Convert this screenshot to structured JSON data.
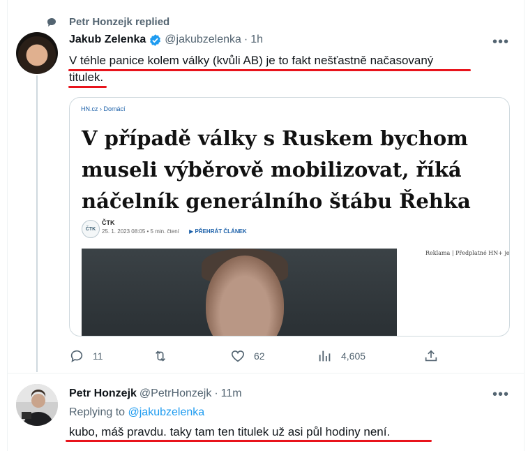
{
  "context": {
    "text": "Petr Honzejk replied",
    "icon": "reply-bubble-icon"
  },
  "tweet1": {
    "name": "Jakub Zelenka",
    "handle": "@jakubzelenka",
    "separator": "·",
    "time": "1h",
    "verified": true,
    "more": "•••",
    "text_line1": "V téhle panice kolem války (kvůli AB) je to fakt nešťastně načasovaný",
    "text_line2_underlined": "titulek",
    "text_line2_rest": ".",
    "card": {
      "breadcrumb": "HN.cz › Domácí",
      "headline": "V případě války s Ruskem bychom museli výběrově mobilizovat, říká náčelník generálního štábu Řehka",
      "author_logo": "ČTK",
      "author": "ČTK",
      "meta": "25. 1. 2023 08:05 • 5 min. čtení",
      "play_label": "▶ PŘEHRÁT ČLÁNEK",
      "ad_text": "Reklama | Předplatné HN+ je zce"
    },
    "actions": {
      "replies": "11",
      "retweets": "",
      "likes": "62",
      "views": "4,605"
    }
  },
  "tweet2": {
    "name": "Petr Honzejk",
    "handle": "@PetrHonzejk",
    "separator": "·",
    "time": "11m",
    "more": "•••",
    "replying_label": "Replying to",
    "replying_mention": "@jakubzelenka",
    "text": "kubo, máš pravdu. taky tam ten titulek už asi půl hodiny není."
  },
  "colors": {
    "accent": "#1d9bf0",
    "underline": "#e8141c",
    "muted": "#536471"
  }
}
